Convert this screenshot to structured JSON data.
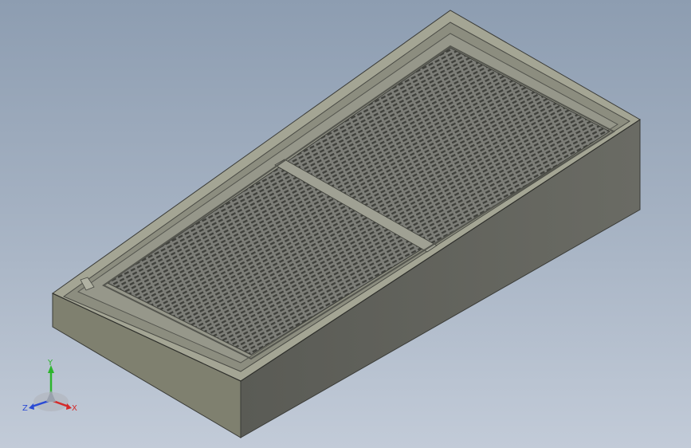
{
  "viewport": {
    "background_top": "#8d9db1",
    "background_bottom": "#c2cbd8"
  },
  "model": {
    "description_icon": "grated-tray-3d-model",
    "colors": {
      "top_face": "#8e8f82",
      "front_face": "#7b7c6e",
      "side_face": "#5f605a",
      "rim": "#a2a393",
      "grate_dark": "#454641",
      "grate_light": "#7d7e78"
    }
  },
  "triad": {
    "x_label": "X",
    "y_label": "Y",
    "z_label": "Z",
    "x_color": "#d42a2a",
    "y_color": "#2db52d",
    "z_color": "#2a4ad4"
  }
}
